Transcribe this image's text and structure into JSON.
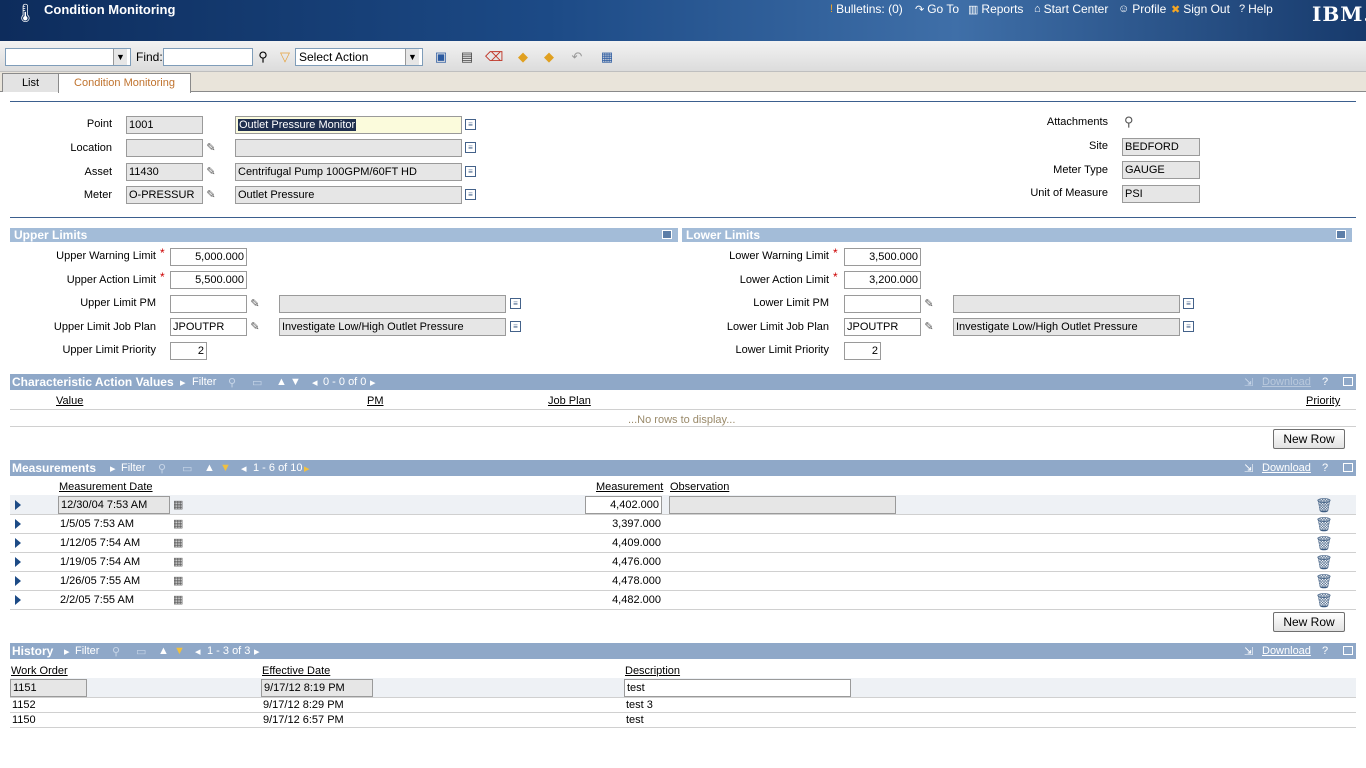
{
  "header": {
    "title": "Condition Monitoring",
    "links": {
      "bulletins": "Bulletins: (0)",
      "goto": "Go To",
      "reports": "Reports",
      "start_center": "Start Center",
      "profile": "Profile",
      "sign_out": "Sign Out",
      "help": "Help"
    },
    "logo": "IBM."
  },
  "toolbar": {
    "find_label": "Find:",
    "find_value": "",
    "action_select": "Select Action"
  },
  "tabs": {
    "list": "List",
    "condition_monitoring": "Condition Monitoring"
  },
  "point_info": {
    "point_label": "Point",
    "point_value": "1001",
    "point_desc": "Outlet Pressure Monitor",
    "location_label": "Location",
    "location_value": "",
    "location_desc": "",
    "asset_label": "Asset",
    "asset_value": "11430",
    "asset_desc": "Centrifugal Pump 100GPM/60FT HD",
    "meter_label": "Meter",
    "meter_value": "O-PRESSUR",
    "meter_desc": "Outlet Pressure",
    "attachments_label": "Attachments",
    "site_label": "Site",
    "site_value": "BEDFORD",
    "meter_type_label": "Meter Type",
    "meter_type_value": "GAUGE",
    "uom_label": "Unit of Measure",
    "uom_value": "PSI"
  },
  "upper_limits": {
    "title": "Upper Limits",
    "warning_label": "Upper Warning Limit",
    "warning_value": "5,000.000",
    "action_label": "Upper Action Limit",
    "action_value": "5,500.000",
    "pm_label": "Upper Limit PM",
    "pm_value": "",
    "pm_desc": "",
    "jobplan_label": "Upper Limit Job Plan",
    "jobplan_value": "JPOUTPR",
    "jobplan_desc": "Investigate Low/High Outlet Pressure",
    "priority_label": "Upper Limit Priority",
    "priority_value": "2"
  },
  "lower_limits": {
    "title": "Lower Limits",
    "warning_label": "Lower Warning Limit",
    "warning_value": "3,500.000",
    "action_label": "Lower Action Limit",
    "action_value": "3,200.000",
    "pm_label": "Lower Limit PM",
    "pm_value": "",
    "pm_desc": "",
    "jobplan_label": "Lower Limit Job Plan",
    "jobplan_value": "JPOUTPR",
    "jobplan_desc": "Investigate Low/High Outlet Pressure",
    "priority_label": "Lower Limit Priority",
    "priority_value": "2"
  },
  "char_actions": {
    "title": "Characteristic Action Values",
    "filter": "Filter",
    "count": "0 - 0 of 0",
    "download": "Download",
    "columns": [
      "Value",
      "PM",
      "Job Plan",
      "Priority"
    ],
    "empty": "...No rows to display...",
    "new_row": "New Row"
  },
  "measurements": {
    "title": "Measurements",
    "filter": "Filter",
    "count": "1 - 6 of 10",
    "download": "Download",
    "col_date": "Measurement Date",
    "col_measurement": "Measurement",
    "col_observation": "Observation",
    "rows": [
      {
        "date": "12/30/04 7:53 AM",
        "value": "4,402.000"
      },
      {
        "date": "1/5/05 7:53 AM",
        "value": "3,397.000"
      },
      {
        "date": "1/12/05 7:54 AM",
        "value": "4,409.000"
      },
      {
        "date": "1/19/05 7:54 AM",
        "value": "4,476.000"
      },
      {
        "date": "1/26/05 7:55 AM",
        "value": "4,478.000"
      },
      {
        "date": "2/2/05 7:55 AM",
        "value": "4,482.000"
      }
    ],
    "new_row": "New Row"
  },
  "history": {
    "title": "History",
    "filter": "Filter",
    "count": "1 - 3 of 3",
    "download": "Download",
    "col_wo": "Work Order",
    "col_date": "Effective Date",
    "col_desc": "Description",
    "rows": [
      {
        "wo": "1151",
        "date": "9/17/12 8:19 PM",
        "desc": "test"
      },
      {
        "wo": "1152",
        "date": "9/17/12 8:29 PM",
        "desc": "test 3"
      },
      {
        "wo": "1150",
        "date": "9/17/12 6:57 PM",
        "desc": "test"
      }
    ]
  }
}
